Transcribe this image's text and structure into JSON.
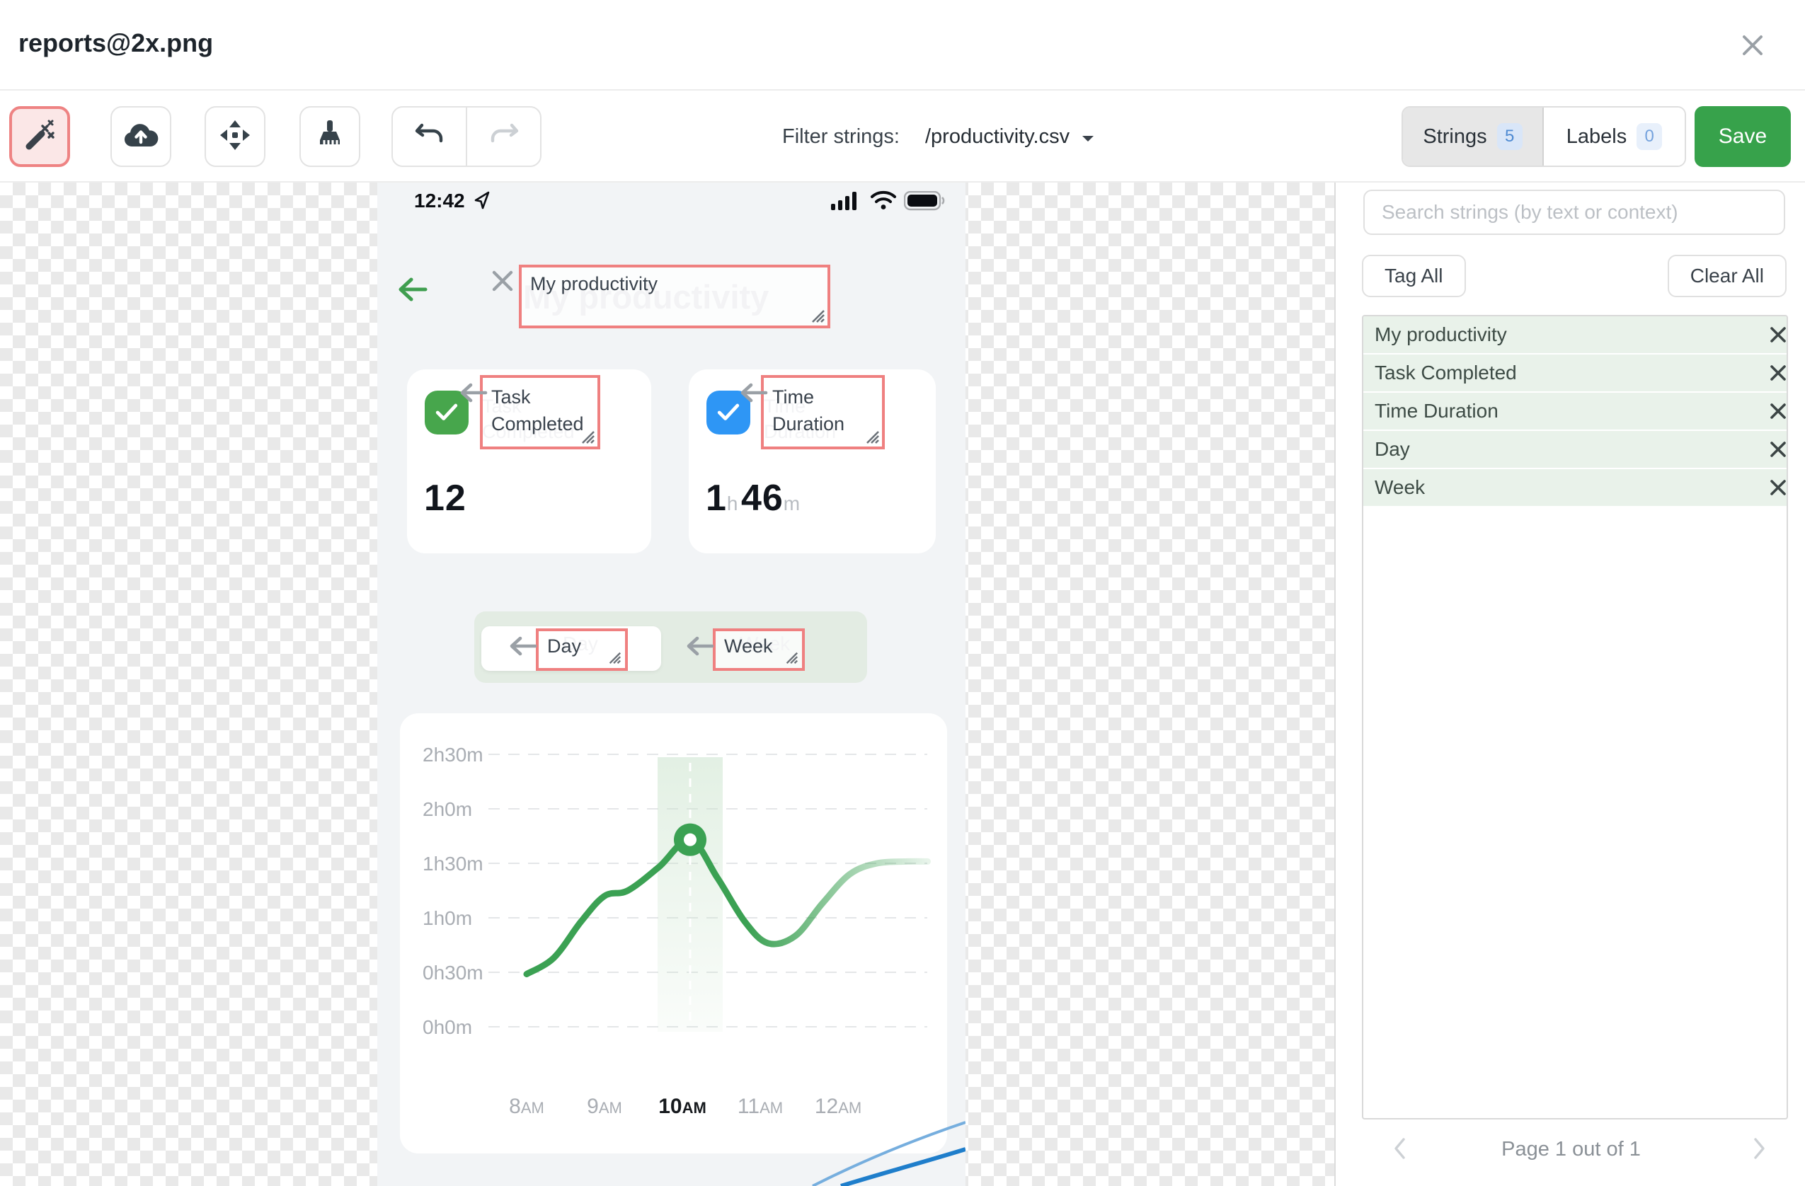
{
  "header": {
    "title": "reports@2x.png"
  },
  "toolbar": {
    "tools": [
      "magic-wand",
      "cloud-upload",
      "move",
      "brush",
      "undo",
      "redo"
    ],
    "filter_label": "Filter strings:",
    "filter_value": "/productivity.csv",
    "tabs": {
      "strings": {
        "label": "Strings",
        "count": "5"
      },
      "labels": {
        "label": "Labels",
        "count": "0"
      }
    },
    "save_label": "Save"
  },
  "phone": {
    "status": {
      "time": "12:42"
    },
    "title": "My productivity",
    "cards": [
      {
        "label": "Task Completed",
        "value": "12"
      },
      {
        "label": "Time Duration",
        "value_h": "1",
        "unit_h": "h",
        "value_m": "46",
        "unit_m": "m"
      }
    ],
    "toggle": {
      "options": [
        "Day",
        "Week"
      ],
      "selected": "Day"
    }
  },
  "chart_data": {
    "type": "line",
    "title": "",
    "xlabel": "",
    "ylabel": "",
    "y_ticks": [
      "2h30m",
      "2h0m",
      "1h30m",
      "1h0m",
      "0h30m",
      "0h0m"
    ],
    "y_tick_minutes": [
      150,
      120,
      90,
      60,
      30,
      0
    ],
    "x_ticks": [
      "8AM",
      "9AM",
      "10AM",
      "11AM",
      "12AM"
    ],
    "x_tick_hours": [
      8,
      9,
      10,
      11,
      12
    ],
    "bold_x_tick": "10AM",
    "ylim_minutes": [
      0,
      150
    ],
    "grid": "dashed-horizontal",
    "highlight_band_hour": 10.1,
    "marker_point_hour_minutes": [
      10.1,
      103
    ],
    "line_color": "#3ba153",
    "series": [
      {
        "name": "Time Duration",
        "points_hour_minutes": [
          [
            8.0,
            29
          ],
          [
            8.35,
            38
          ],
          [
            8.7,
            58
          ],
          [
            9.0,
            72
          ],
          [
            9.3,
            75
          ],
          [
            9.7,
            88
          ],
          [
            10.1,
            103
          ],
          [
            10.45,
            82
          ],
          [
            10.8,
            58
          ],
          [
            11.1,
            46
          ],
          [
            11.45,
            50
          ],
          [
            11.8,
            68
          ],
          [
            12.15,
            84
          ],
          [
            12.5,
            90
          ],
          [
            12.9,
            91
          ],
          [
            13.15,
            91
          ]
        ]
      }
    ]
  },
  "sidebar": {
    "search_placeholder": "Search strings (by text or context)",
    "tag_all": "Tag All",
    "clear_all": "Clear All",
    "strings": [
      "My productivity",
      "Task Completed",
      "Time Duration",
      "Day",
      "Week"
    ],
    "pagination": "Page 1 out of 1"
  },
  "colors": {
    "annotation_red": "#ef8080",
    "save_green": "#37a24b",
    "chart_green": "#3ba153",
    "card_icon_green": "#47a64c",
    "card_icon_blue": "#2e96f5",
    "list_row_green": "#e9f2ea",
    "badge_blue_bg": "#d9e6f8"
  }
}
